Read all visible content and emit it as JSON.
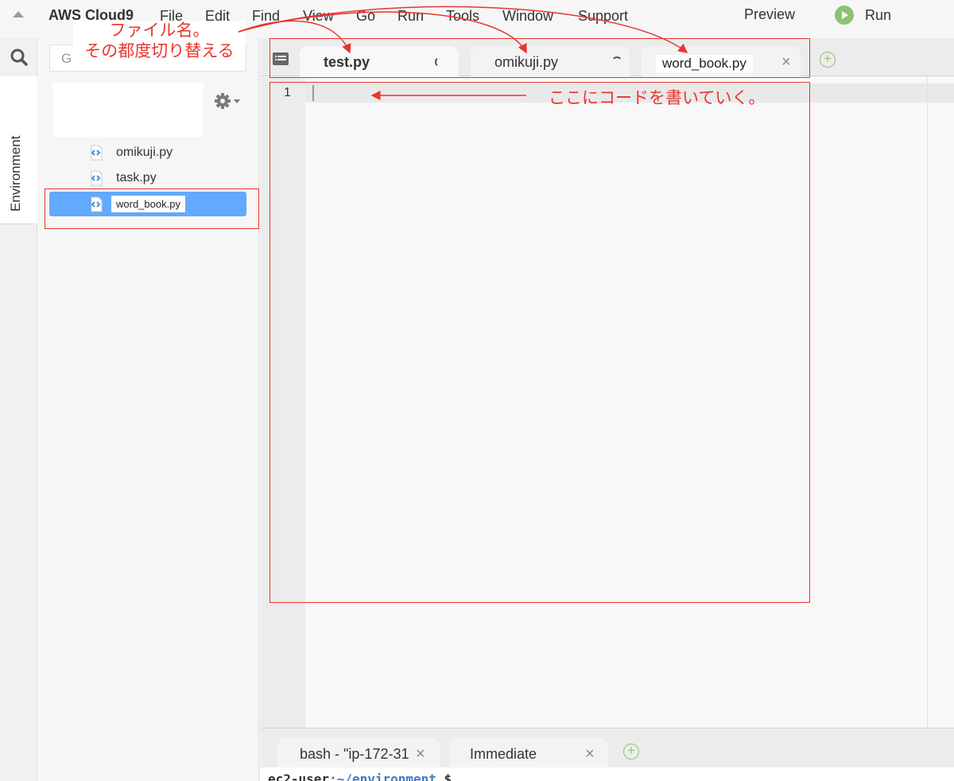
{
  "menubar": {
    "brand": "AWS Cloud9",
    "items": [
      "File",
      "Edit",
      "Find",
      "View",
      "Go",
      "Run",
      "Tools",
      "Window",
      "Support"
    ],
    "preview": "Preview",
    "run": "Run"
  },
  "sidebar": {
    "search_placeholder": "G",
    "panel_tab": "Environment"
  },
  "file_tree": {
    "files": [
      {
        "name": "omikuji.py"
      },
      {
        "name": "task.py"
      },
      {
        "name": "word_book.py",
        "selected": true
      }
    ]
  },
  "editor": {
    "tabs": [
      {
        "label": "test.py",
        "active": true
      },
      {
        "label": "omikuji.py"
      },
      {
        "label": "word_book.py"
      }
    ],
    "line_numbers": [
      "1"
    ]
  },
  "bottom_panel": {
    "tabs": [
      {
        "label": "bash - \"ip-172-31"
      },
      {
        "label": "Immediate"
      }
    ],
    "prompt_user": "ec2-user",
    "prompt_path": ":~/environment",
    "prompt_symbol": " $ "
  },
  "annotations": {
    "filename_note_line1": "ファイル名。",
    "filename_note_line2": "その都度切り替える",
    "code_note": "ここにコードを書いていく。"
  },
  "colors": {
    "annotation": "#e8352d",
    "selection": "#63a9ff",
    "run_green": "#8cc276"
  }
}
